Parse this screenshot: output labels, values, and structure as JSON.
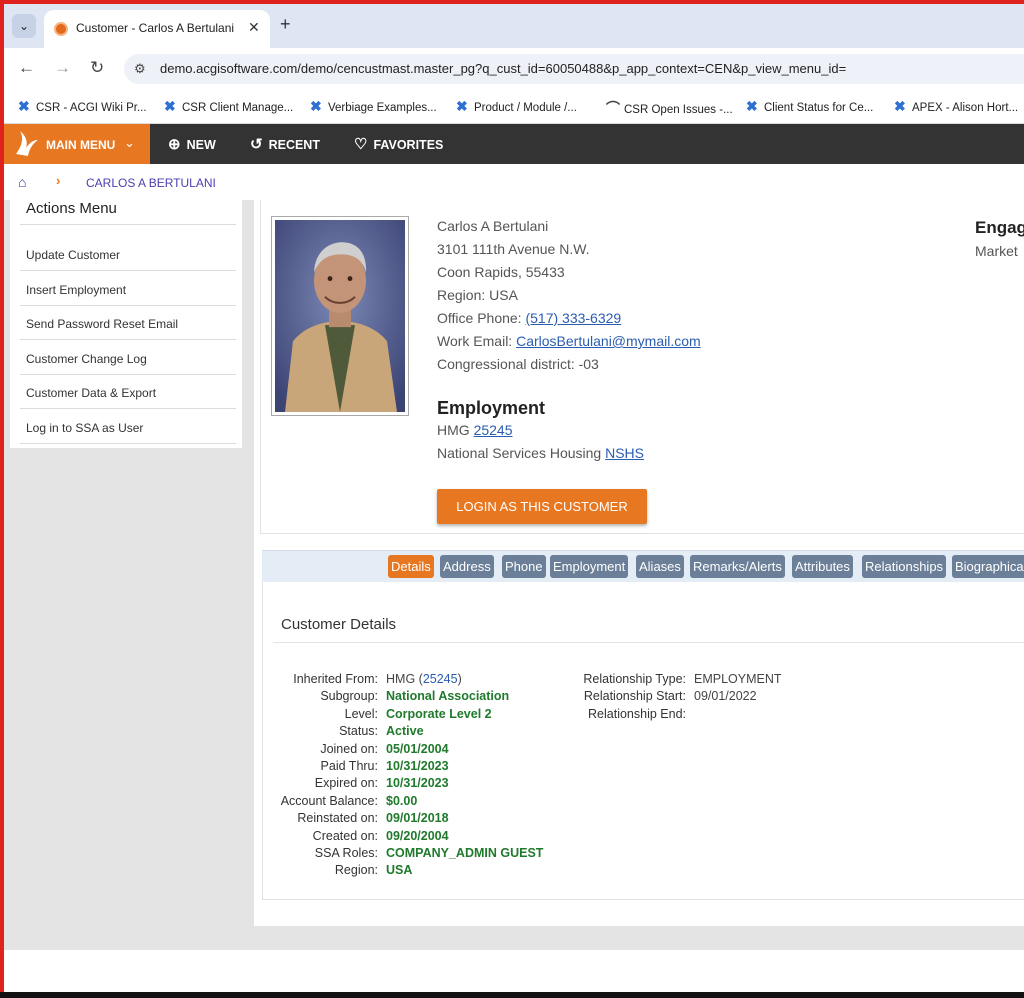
{
  "browser": {
    "tab_title": "Customer - Carlos A Bertulani",
    "url": "demo.acgisoftware.com/demo/cencustmast.master_pg?q_cust_id=60050488&p_app_context=CEN&p_view_menu_id=",
    "bookmarks": [
      {
        "label": "CSR - ACGI Wiki Pr...",
        "icon": "x-icon"
      },
      {
        "label": "CSR Client Manage...",
        "icon": "x-icon"
      },
      {
        "label": "Verbiage Examples...",
        "icon": "x-icon"
      },
      {
        "label": "Product / Module /...",
        "icon": "x-icon"
      },
      {
        "label": "CSR Open Issues -...",
        "icon": "arc-icon"
      },
      {
        "label": "Client Status for Ce...",
        "icon": "x-icon"
      },
      {
        "label": "APEX - Alison Hort...",
        "icon": "x-icon"
      }
    ]
  },
  "appbar": {
    "main_menu": "MAIN MENU",
    "new": "NEW",
    "recent": "RECENT",
    "favorites": "FAVORITES"
  },
  "breadcrumb": {
    "current": "CARLOS A BERTULANI"
  },
  "actions": {
    "title": "Actions Menu",
    "items": [
      "Update Customer",
      "Insert Employment",
      "Send Password Reset Email",
      "Customer Change Log",
      "Customer Data & Export",
      "Log in to SSA as User"
    ]
  },
  "profile": {
    "name": "Carlos A Bertulani",
    "street": "3101 111th Avenue N.W.",
    "city": "Coon Rapids, 55433",
    "region": "Region: USA",
    "phone_label": "Office Phone: ",
    "phone": "(517) 333-6329",
    "email_label": "Work Email: ",
    "email": "CarlosBertulani@mymail.com",
    "district": "Congressional district: -03",
    "employment_title": "Employment",
    "employer_prefix": "HMG ",
    "employer_id": "25245",
    "org_prefix": "National Services Housing ",
    "org_code": "NSHS",
    "login_button": "LOGIN AS THIS CUSTOMER",
    "engage_title": "Engag",
    "engage_sub": "Market"
  },
  "tabs": [
    "Details",
    "Address",
    "Phone",
    "Employment",
    "Aliases",
    "Remarks/Alerts",
    "Attributes",
    "Relationships",
    "Biographica"
  ],
  "details": {
    "title": "Customer Details",
    "inherited_label": "Inherited From:",
    "inherited_prefix": "HMG (",
    "inherited_id": "25245",
    "inherited_suffix": ")",
    "left": [
      {
        "label": "Subgroup:",
        "value": "National Association"
      },
      {
        "label": "Level:",
        "value": "Corporate Level 2"
      },
      {
        "label": "Status:",
        "value": "Active"
      },
      {
        "label": "Joined on:",
        "value": "05/01/2004"
      },
      {
        "label": "Paid Thru:",
        "value": "10/31/2023"
      },
      {
        "label": "Expired on:",
        "value": "10/31/2023"
      },
      {
        "label": "Account Balance:",
        "value": "$0.00"
      },
      {
        "label": "Reinstated on:",
        "value": "09/01/2018"
      },
      {
        "label": "Created on:",
        "value": "09/20/2004"
      },
      {
        "label": "SSA Roles:",
        "value": "COMPANY_ADMIN GUEST"
      },
      {
        "label": "Region:",
        "value": "USA"
      }
    ],
    "right": [
      {
        "label": "Relationship Type:",
        "value": "EMPLOYMENT"
      },
      {
        "label": "Relationship Start:",
        "value": "09/01/2022"
      },
      {
        "label": "Relationship End:",
        "value": ""
      }
    ]
  },
  "colors": {
    "accent": "#e87722",
    "appbar": "#333333",
    "tab": "#6b7f99",
    "value_green": "#1f7a2c",
    "frame_red": "#e0221f"
  }
}
